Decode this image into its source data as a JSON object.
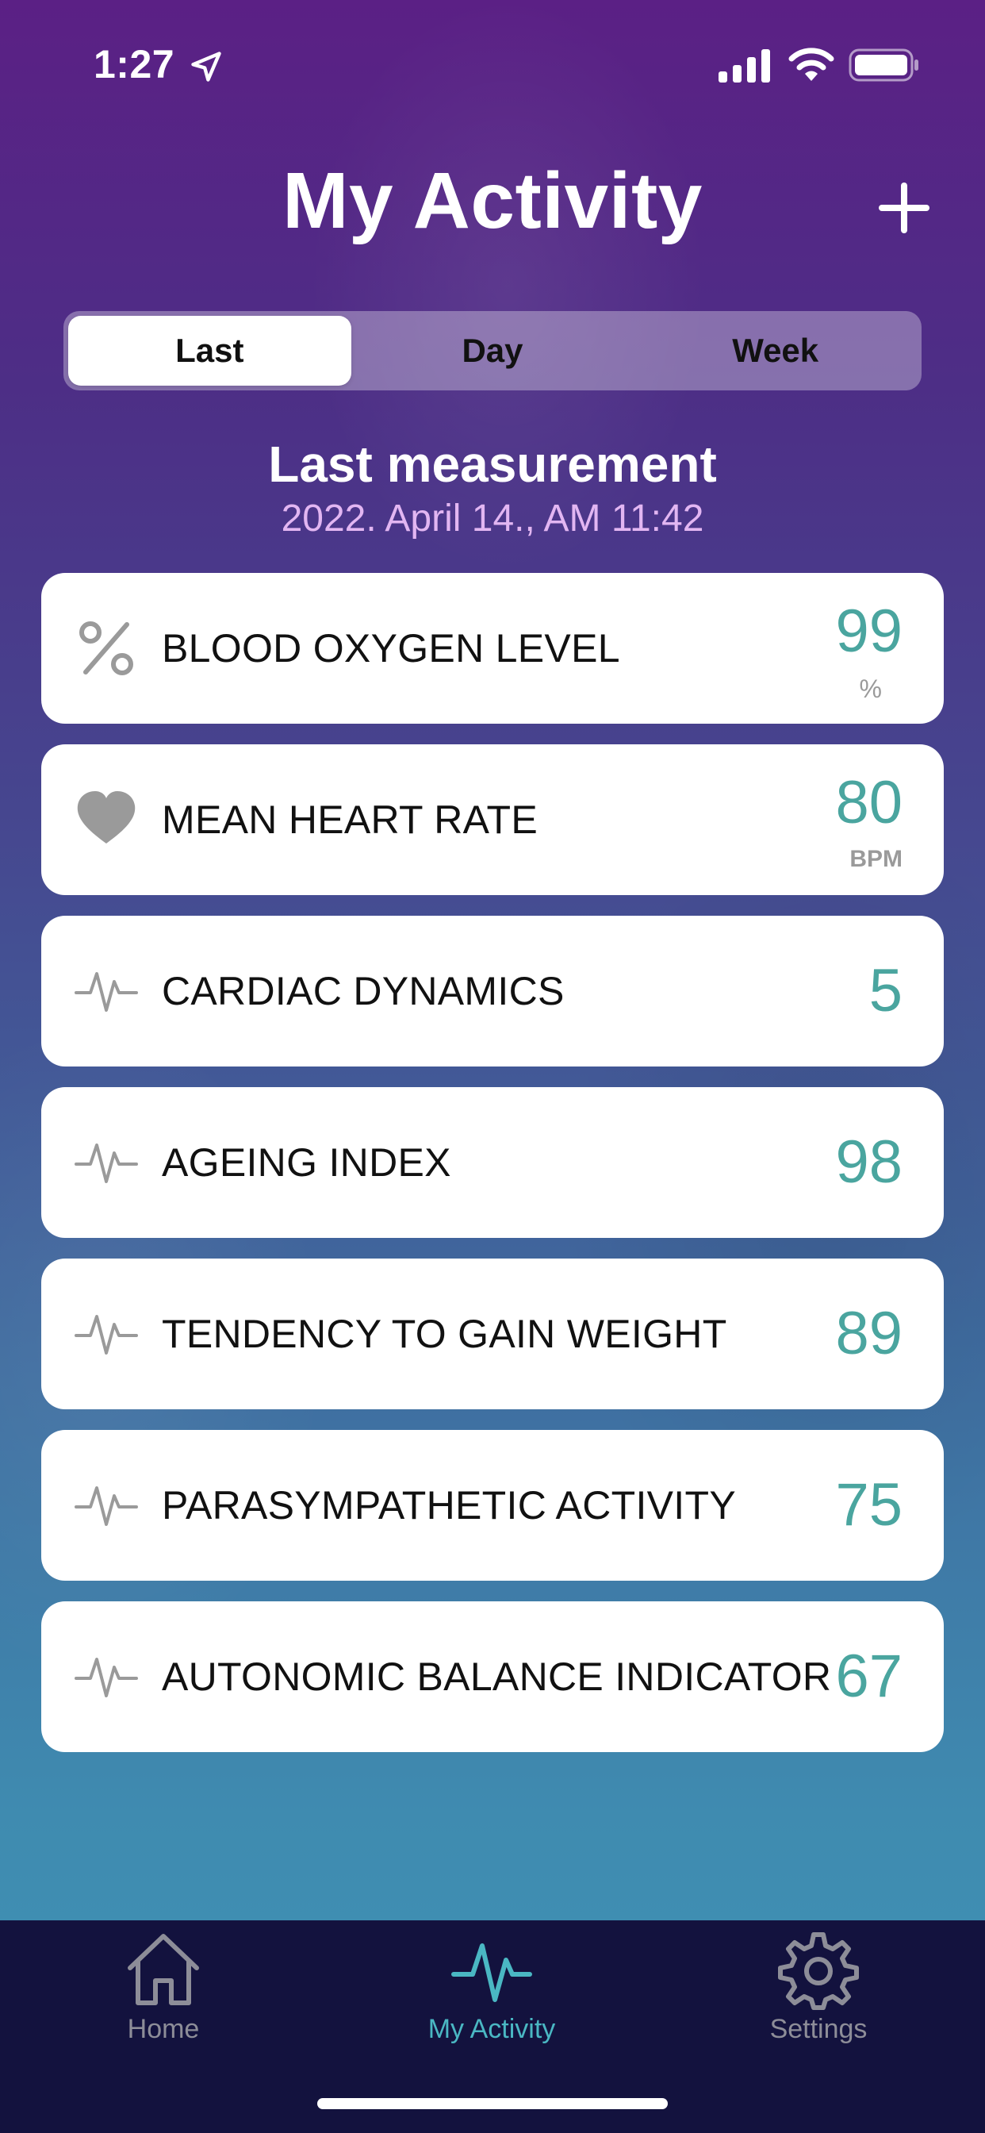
{
  "status_bar": {
    "time": "1:27"
  },
  "header": {
    "title": "My Activity",
    "add_icon": "plus-icon"
  },
  "segments": [
    {
      "label": "Last",
      "active": true
    },
    {
      "label": "Day",
      "active": false
    },
    {
      "label": "Week",
      "active": false
    }
  ],
  "measurement": {
    "title": "Last measurement",
    "date": "2022. April 14., AM 11:42"
  },
  "cards": [
    {
      "icon": "percent-icon",
      "label": "BLOOD OXYGEN LEVEL",
      "value": "99",
      "unit": "%"
    },
    {
      "icon": "heart-icon",
      "label": "MEAN HEART RATE",
      "value": "80",
      "unit": "BPM"
    },
    {
      "icon": "pulse-icon",
      "label": "CARDIAC DYNAMICS",
      "value": "5"
    },
    {
      "icon": "pulse-icon",
      "label": "AGEING INDEX",
      "value": "98"
    },
    {
      "icon": "pulse-icon",
      "label": "TENDENCY TO GAIN WEIGHT",
      "value": "89"
    },
    {
      "icon": "pulse-icon",
      "label": "PARASYMPATHETIC ACTIVITY",
      "value": "75"
    },
    {
      "icon": "pulse-icon",
      "label": "AUTONOMIC BALANCE INDICATOR",
      "value": "67"
    }
  ],
  "tab_bar": {
    "home": "Home",
    "activity": "My Activity",
    "settings": "Settings"
  },
  "colors": {
    "accent": "#4aa59f",
    "tab_active": "#4ab7c3",
    "tab_bar_bg": "#13123e",
    "date_text": "#e2b6f2"
  }
}
